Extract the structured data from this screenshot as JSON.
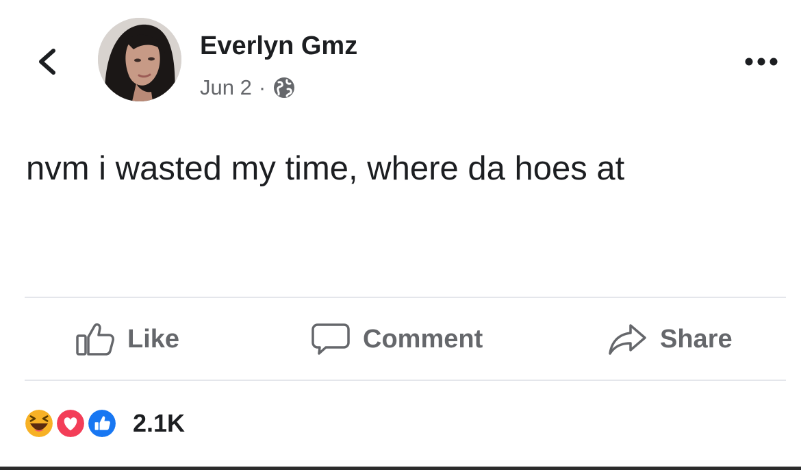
{
  "post": {
    "author_name": "Everlyn Gmz",
    "date": "Jun 2",
    "separator": "·",
    "privacy_icon": "globe-icon",
    "text": "nvm i wasted my time, where da hoes at"
  },
  "actions": {
    "like_label": "Like",
    "comment_label": "Comment",
    "share_label": "Share"
  },
  "reactions": {
    "icons": [
      "haha-reaction-icon",
      "love-reaction-icon",
      "like-reaction-icon"
    ],
    "count": "2.1K"
  },
  "colors": {
    "text": "#1c1e21",
    "secondary": "#65676b",
    "divider": "#e4e6eb",
    "like_blue": "#1877f2",
    "love_red": "#f33e58",
    "haha_yellow": "#f7b125"
  }
}
